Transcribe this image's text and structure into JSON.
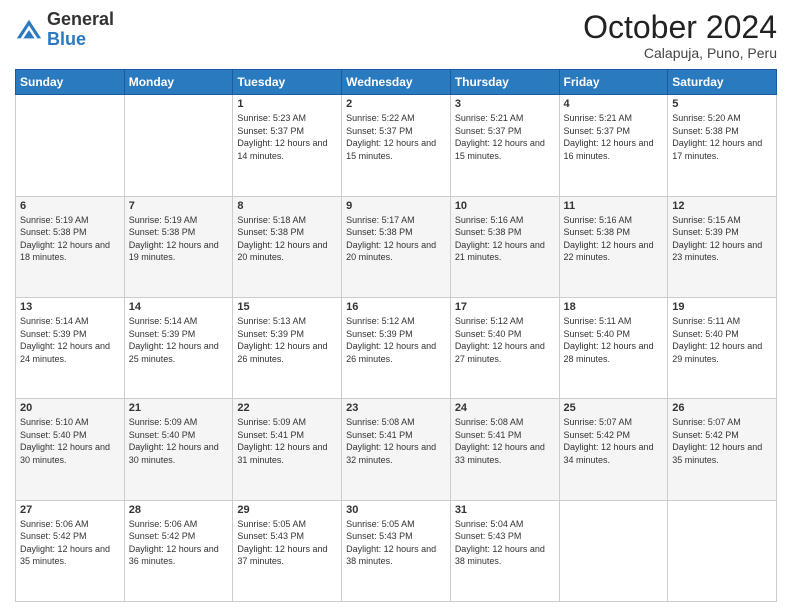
{
  "header": {
    "logo_general": "General",
    "logo_blue": "Blue",
    "month_title": "October 2024",
    "subtitle": "Calapuja, Puno, Peru"
  },
  "days_of_week": [
    "Sunday",
    "Monday",
    "Tuesday",
    "Wednesday",
    "Thursday",
    "Friday",
    "Saturday"
  ],
  "weeks": [
    [
      {
        "day": "",
        "info": ""
      },
      {
        "day": "",
        "info": ""
      },
      {
        "day": "1",
        "info": "Sunrise: 5:23 AM\nSunset: 5:37 PM\nDaylight: 12 hours and 14 minutes."
      },
      {
        "day": "2",
        "info": "Sunrise: 5:22 AM\nSunset: 5:37 PM\nDaylight: 12 hours and 15 minutes."
      },
      {
        "day": "3",
        "info": "Sunrise: 5:21 AM\nSunset: 5:37 PM\nDaylight: 12 hours and 15 minutes."
      },
      {
        "day": "4",
        "info": "Sunrise: 5:21 AM\nSunset: 5:37 PM\nDaylight: 12 hours and 16 minutes."
      },
      {
        "day": "5",
        "info": "Sunrise: 5:20 AM\nSunset: 5:38 PM\nDaylight: 12 hours and 17 minutes."
      }
    ],
    [
      {
        "day": "6",
        "info": "Sunrise: 5:19 AM\nSunset: 5:38 PM\nDaylight: 12 hours and 18 minutes."
      },
      {
        "day": "7",
        "info": "Sunrise: 5:19 AM\nSunset: 5:38 PM\nDaylight: 12 hours and 19 minutes."
      },
      {
        "day": "8",
        "info": "Sunrise: 5:18 AM\nSunset: 5:38 PM\nDaylight: 12 hours and 20 minutes."
      },
      {
        "day": "9",
        "info": "Sunrise: 5:17 AM\nSunset: 5:38 PM\nDaylight: 12 hours and 20 minutes."
      },
      {
        "day": "10",
        "info": "Sunrise: 5:16 AM\nSunset: 5:38 PM\nDaylight: 12 hours and 21 minutes."
      },
      {
        "day": "11",
        "info": "Sunrise: 5:16 AM\nSunset: 5:38 PM\nDaylight: 12 hours and 22 minutes."
      },
      {
        "day": "12",
        "info": "Sunrise: 5:15 AM\nSunset: 5:39 PM\nDaylight: 12 hours and 23 minutes."
      }
    ],
    [
      {
        "day": "13",
        "info": "Sunrise: 5:14 AM\nSunset: 5:39 PM\nDaylight: 12 hours and 24 minutes."
      },
      {
        "day": "14",
        "info": "Sunrise: 5:14 AM\nSunset: 5:39 PM\nDaylight: 12 hours and 25 minutes."
      },
      {
        "day": "15",
        "info": "Sunrise: 5:13 AM\nSunset: 5:39 PM\nDaylight: 12 hours and 26 minutes."
      },
      {
        "day": "16",
        "info": "Sunrise: 5:12 AM\nSunset: 5:39 PM\nDaylight: 12 hours and 26 minutes."
      },
      {
        "day": "17",
        "info": "Sunrise: 5:12 AM\nSunset: 5:40 PM\nDaylight: 12 hours and 27 minutes."
      },
      {
        "day": "18",
        "info": "Sunrise: 5:11 AM\nSunset: 5:40 PM\nDaylight: 12 hours and 28 minutes."
      },
      {
        "day": "19",
        "info": "Sunrise: 5:11 AM\nSunset: 5:40 PM\nDaylight: 12 hours and 29 minutes."
      }
    ],
    [
      {
        "day": "20",
        "info": "Sunrise: 5:10 AM\nSunset: 5:40 PM\nDaylight: 12 hours and 30 minutes."
      },
      {
        "day": "21",
        "info": "Sunrise: 5:09 AM\nSunset: 5:40 PM\nDaylight: 12 hours and 30 minutes."
      },
      {
        "day": "22",
        "info": "Sunrise: 5:09 AM\nSunset: 5:41 PM\nDaylight: 12 hours and 31 minutes."
      },
      {
        "day": "23",
        "info": "Sunrise: 5:08 AM\nSunset: 5:41 PM\nDaylight: 12 hours and 32 minutes."
      },
      {
        "day": "24",
        "info": "Sunrise: 5:08 AM\nSunset: 5:41 PM\nDaylight: 12 hours and 33 minutes."
      },
      {
        "day": "25",
        "info": "Sunrise: 5:07 AM\nSunset: 5:42 PM\nDaylight: 12 hours and 34 minutes."
      },
      {
        "day": "26",
        "info": "Sunrise: 5:07 AM\nSunset: 5:42 PM\nDaylight: 12 hours and 35 minutes."
      }
    ],
    [
      {
        "day": "27",
        "info": "Sunrise: 5:06 AM\nSunset: 5:42 PM\nDaylight: 12 hours and 35 minutes."
      },
      {
        "day": "28",
        "info": "Sunrise: 5:06 AM\nSunset: 5:42 PM\nDaylight: 12 hours and 36 minutes."
      },
      {
        "day": "29",
        "info": "Sunrise: 5:05 AM\nSunset: 5:43 PM\nDaylight: 12 hours and 37 minutes."
      },
      {
        "day": "30",
        "info": "Sunrise: 5:05 AM\nSunset: 5:43 PM\nDaylight: 12 hours and 38 minutes."
      },
      {
        "day": "31",
        "info": "Sunrise: 5:04 AM\nSunset: 5:43 PM\nDaylight: 12 hours and 38 minutes."
      },
      {
        "day": "",
        "info": ""
      },
      {
        "day": "",
        "info": ""
      }
    ]
  ]
}
